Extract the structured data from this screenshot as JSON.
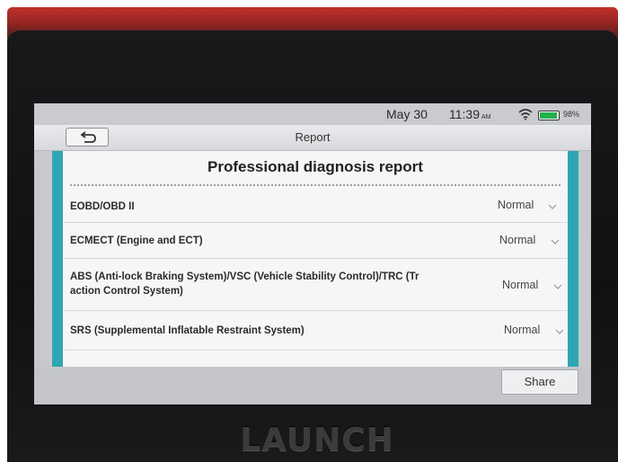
{
  "status_bar": {
    "date": "May 30",
    "time": "11:39",
    "ampm": "AM",
    "battery": "98%",
    "battery_level": 0.98,
    "icons": [
      "wifi-icon",
      "battery-icon"
    ]
  },
  "header": {
    "back_icon": "back-arrow-icon",
    "title": "Report"
  },
  "report": {
    "heading": "Professional diagnosis report",
    "rows": [
      {
        "label": "EOBD/OBD II",
        "value": "Normal"
      },
      {
        "label": "ECMECT (Engine and ECT)",
        "value": "Normal"
      },
      {
        "label": "ABS (Anti-lock Braking System)/VSC (Vehicle Stability Control)/TRC (Tr",
        "label2": "action Control System)",
        "value": "Normal"
      },
      {
        "label": "SRS (Supplemental Inflatable Restraint System)",
        "value": "Normal"
      }
    ]
  },
  "footer": {
    "share_label": "Share"
  },
  "device": {
    "brand": "LAUNCH"
  },
  "colors": {
    "accent": "#2fa6b3",
    "battery": "#23b14d"
  }
}
